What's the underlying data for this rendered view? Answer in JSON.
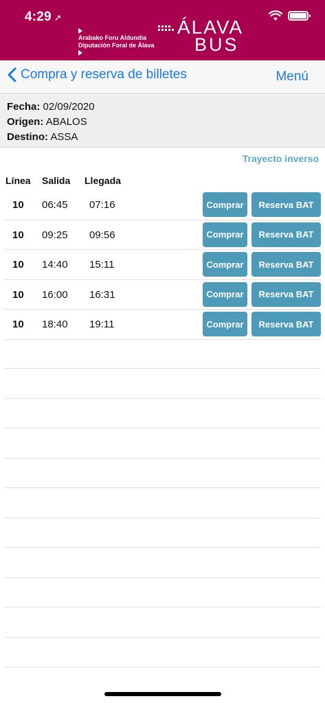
{
  "status_bar": {
    "time": "4:29",
    "location_glyph": "➚"
  },
  "brand": {
    "left_line1": "Arabako Foru Aldundia",
    "left_line2": "Diputación Foral de Álava",
    "title_top": "ÁLAVA",
    "title_bottom": "BUS",
    "color": "#a8004e"
  },
  "nav": {
    "back_label": "Compra y reserva de billetes",
    "menu_label": "Menú",
    "accent": "#1a7ae8"
  },
  "trip": {
    "date_label": "Fecha:",
    "date": "02/09/2020",
    "origin_label": "Origen:",
    "origin": "ABALOS",
    "destination_label": "Destino:",
    "destination": "ASSA"
  },
  "inverse_label": "Trayecto inverso",
  "table": {
    "headers": {
      "line": "Línea",
      "departure": "Salida",
      "arrival": "Llegada"
    },
    "buy_label": "Comprar",
    "reserve_label": "Reserva BAT",
    "button_color": "#4d9ab9",
    "rows": [
      {
        "line": "10",
        "departure": "06:45",
        "arrival": "07:16"
      },
      {
        "line": "10",
        "departure": "09:25",
        "arrival": "09:56"
      },
      {
        "line": "10",
        "departure": "14:40",
        "arrival": "15:11"
      },
      {
        "line": "10",
        "departure": "16:00",
        "arrival": "16:31"
      },
      {
        "line": "10",
        "departure": "18:40",
        "arrival": "19:11"
      }
    ]
  }
}
